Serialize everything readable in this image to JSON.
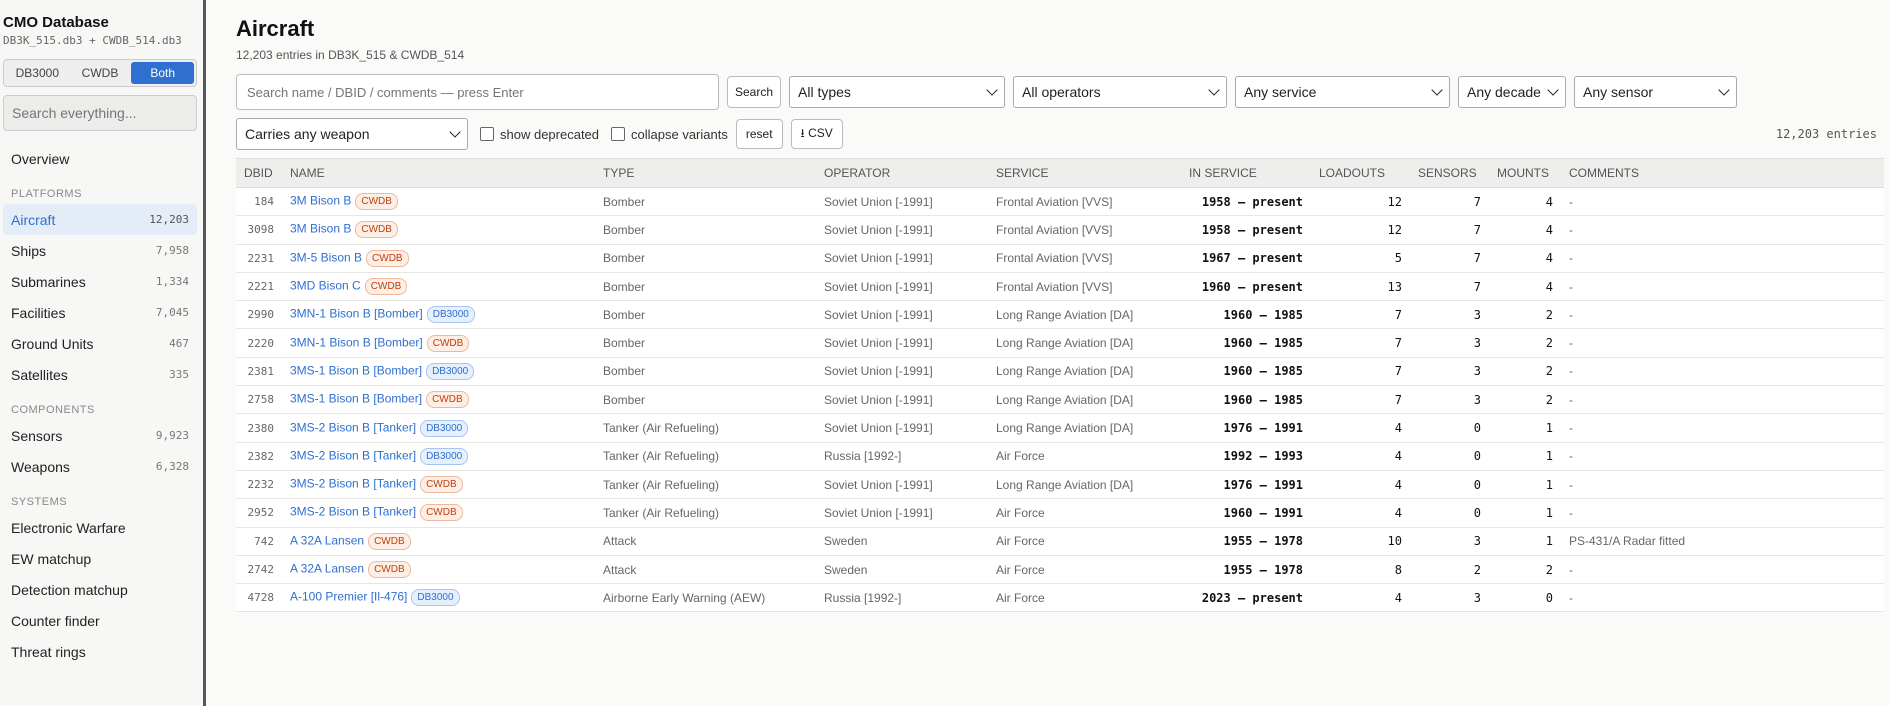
{
  "app": {
    "title": "CMO Database",
    "subtitle": "DB3K_515.db3 + CWDB_514.db3"
  },
  "db_toggle": {
    "options": [
      "DB3000",
      "CWDB",
      "Both"
    ],
    "selected": "Both"
  },
  "sidebar_search": {
    "placeholder": "Search everything..."
  },
  "sidebar": {
    "overview": "Overview",
    "platforms_title": "PLATFORMS",
    "platforms": [
      {
        "label": "Aircraft",
        "count": "12,203",
        "active": true
      },
      {
        "label": "Ships",
        "count": "7,958"
      },
      {
        "label": "Submarines",
        "count": "1,334"
      },
      {
        "label": "Facilities",
        "count": "7,045"
      },
      {
        "label": "Ground Units",
        "count": "467"
      },
      {
        "label": "Satellites",
        "count": "335"
      }
    ],
    "components_title": "COMPONENTS",
    "components": [
      {
        "label": "Sensors",
        "count": "9,923"
      },
      {
        "label": "Weapons",
        "count": "6,328"
      }
    ],
    "systems_title": "SYSTEMS",
    "systems": [
      {
        "label": "Electronic Warfare"
      },
      {
        "label": "EW matchup"
      },
      {
        "label": "Detection matchup"
      },
      {
        "label": "Counter finder"
      },
      {
        "label": "Threat rings"
      }
    ]
  },
  "page": {
    "title": "Aircraft",
    "subtitle": "12,203 entries in DB3K_515 & CWDB_514"
  },
  "filters": {
    "search_placeholder": "Search name / DBID / comments — press Enter",
    "search_button": "Search",
    "type": "All types",
    "operator": "All operators",
    "service": "Any service",
    "decade": "Any decade",
    "sensor": "Any sensor",
    "weapon": "Carries any weapon",
    "show_deprecated": "show deprecated",
    "collapse_variants": "collapse variants",
    "reset": "reset",
    "csv": "⭳ CSV",
    "entries": "12,203 entries"
  },
  "table": {
    "columns": [
      "DBID",
      "NAME",
      "TYPE",
      "OPERATOR",
      "SERVICE",
      "IN SERVICE",
      "LOADOUTS",
      "SENSORS",
      "MOUNTS",
      "COMMENTS"
    ],
    "rows": [
      {
        "dbid": "184",
        "name": "3M Bison B",
        "badge": "CWDB",
        "type": "Bomber",
        "operator": "Soviet Union [-1991]",
        "service": "Frontal Aviation [VVS]",
        "in_service": "1958 – present",
        "loadouts": "12",
        "sensors": "7",
        "mounts": "4",
        "comments": "-"
      },
      {
        "dbid": "3098",
        "name": "3M Bison B",
        "badge": "CWDB",
        "type": "Bomber",
        "operator": "Soviet Union [-1991]",
        "service": "Frontal Aviation [VVS]",
        "in_service": "1958 – present",
        "loadouts": "12",
        "sensors": "7",
        "mounts": "4",
        "comments": "-"
      },
      {
        "dbid": "2231",
        "name": "3M-5 Bison B",
        "badge": "CWDB",
        "type": "Bomber",
        "operator": "Soviet Union [-1991]",
        "service": "Frontal Aviation [VVS]",
        "in_service": "1967 – present",
        "loadouts": "5",
        "sensors": "7",
        "mounts": "4",
        "comments": "-"
      },
      {
        "dbid": "2221",
        "name": "3MD Bison C",
        "badge": "CWDB",
        "type": "Bomber",
        "operator": "Soviet Union [-1991]",
        "service": "Frontal Aviation [VVS]",
        "in_service": "1960 – present",
        "loadouts": "13",
        "sensors": "7",
        "mounts": "4",
        "comments": "-"
      },
      {
        "dbid": "2990",
        "name": "3MN-1 Bison B [Bomber]",
        "badge": "DB3000",
        "type": "Bomber",
        "operator": "Soviet Union [-1991]",
        "service": "Long Range Aviation [DA]",
        "in_service": "1960 – 1985",
        "loadouts": "7",
        "sensors": "3",
        "mounts": "2",
        "comments": "-"
      },
      {
        "dbid": "2220",
        "name": "3MN-1 Bison B [Bomber]",
        "badge": "CWDB",
        "type": "Bomber",
        "operator": "Soviet Union [-1991]",
        "service": "Long Range Aviation [DA]",
        "in_service": "1960 – 1985",
        "loadouts": "7",
        "sensors": "3",
        "mounts": "2",
        "comments": "-"
      },
      {
        "dbid": "2381",
        "name": "3MS-1 Bison B [Bomber]",
        "badge": "DB3000",
        "type": "Bomber",
        "operator": "Soviet Union [-1991]",
        "service": "Long Range Aviation [DA]",
        "in_service": "1960 – 1985",
        "loadouts": "7",
        "sensors": "3",
        "mounts": "2",
        "comments": "-"
      },
      {
        "dbid": "2758",
        "name": "3MS-1 Bison B [Bomber]",
        "badge": "CWDB",
        "type": "Bomber",
        "operator": "Soviet Union [-1991]",
        "service": "Long Range Aviation [DA]",
        "in_service": "1960 – 1985",
        "loadouts": "7",
        "sensors": "3",
        "mounts": "2",
        "comments": "-"
      },
      {
        "dbid": "2380",
        "name": "3MS-2 Bison B [Tanker]",
        "badge": "DB3000",
        "type": "Tanker (Air Refueling)",
        "operator": "Soviet Union [-1991]",
        "service": "Long Range Aviation [DA]",
        "in_service": "1976 – 1991",
        "loadouts": "4",
        "sensors": "0",
        "mounts": "1",
        "comments": "-"
      },
      {
        "dbid": "2382",
        "name": "3MS-2 Bison B [Tanker]",
        "badge": "DB3000",
        "type": "Tanker (Air Refueling)",
        "operator": "Russia [1992-]",
        "service": "Air Force",
        "in_service": "1992 – 1993",
        "loadouts": "4",
        "sensors": "0",
        "mounts": "1",
        "comments": "-"
      },
      {
        "dbid": "2232",
        "name": "3MS-2 Bison B [Tanker]",
        "badge": "CWDB",
        "type": "Tanker (Air Refueling)",
        "operator": "Soviet Union [-1991]",
        "service": "Long Range Aviation [DA]",
        "in_service": "1976 – 1991",
        "loadouts": "4",
        "sensors": "0",
        "mounts": "1",
        "comments": "-"
      },
      {
        "dbid": "2952",
        "name": "3MS-2 Bison B [Tanker]",
        "badge": "CWDB",
        "type": "Tanker (Air Refueling)",
        "operator": "Soviet Union [-1991]",
        "service": "Air Force",
        "in_service": "1960 – 1991",
        "loadouts": "4",
        "sensors": "0",
        "mounts": "1",
        "comments": "-"
      },
      {
        "dbid": "742",
        "name": "A 32A Lansen",
        "badge": "CWDB",
        "type": "Attack",
        "operator": "Sweden",
        "service": "Air Force",
        "in_service": "1955 – 1978",
        "loadouts": "10",
        "sensors": "3",
        "mounts": "1",
        "comments": "PS-431/A Radar fitted"
      },
      {
        "dbid": "2742",
        "name": "A 32A Lansen",
        "badge": "CWDB",
        "type": "Attack",
        "operator": "Sweden",
        "service": "Air Force",
        "in_service": "1955 – 1978",
        "loadouts": "8",
        "sensors": "2",
        "mounts": "2",
        "comments": "-"
      },
      {
        "dbid": "4728",
        "name": "A-100 Premier [Il-476]",
        "badge": "DB3000",
        "type": "Airborne Early Warning (AEW)",
        "operator": "Russia [1992-]",
        "service": "Air Force",
        "in_service": "2023 – present",
        "loadouts": "4",
        "sensors": "3",
        "mounts": "0",
        "comments": "-"
      }
    ]
  }
}
